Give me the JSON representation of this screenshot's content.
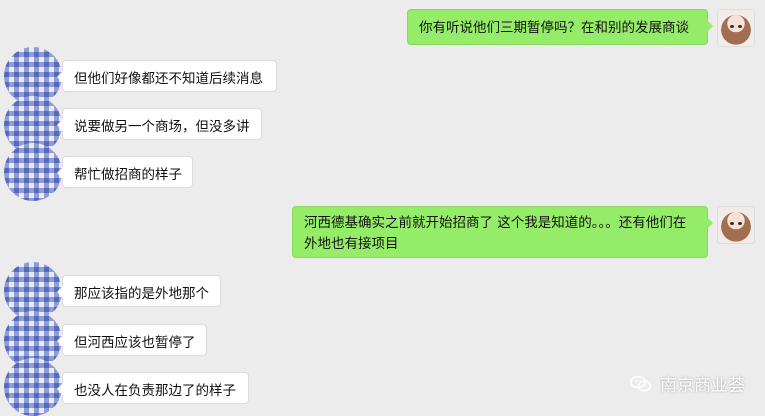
{
  "conversation": {
    "messages": [
      {
        "side": "right",
        "text": "你有听说他们三期暂停吗？在和别的发展商谈"
      },
      {
        "side": "left",
        "text": "但他们好像都还不知道后续消息"
      },
      {
        "side": "left",
        "text": "说要做另一个商场，但没多讲"
      },
      {
        "side": "left",
        "text": "帮忙做招商的样子"
      },
      {
        "side": "right",
        "text": "河西德基确实之前就开始招商了 这个我是知道的。。。还有他们在外地也有接项目"
      },
      {
        "side": "left",
        "text": "那应该指的是外地那个"
      },
      {
        "side": "left",
        "text": "但河西应该也暂停了"
      },
      {
        "side": "left",
        "text": "也没人在负责那边了的样子"
      }
    ]
  },
  "watermark": {
    "icon": "wechat-icon",
    "label": "南京商业荟"
  },
  "colors": {
    "background": "#ececec",
    "bubble_left": "#ffffff",
    "bubble_right": "#95ec69",
    "avatar_pattern": "#8c9bd7"
  }
}
